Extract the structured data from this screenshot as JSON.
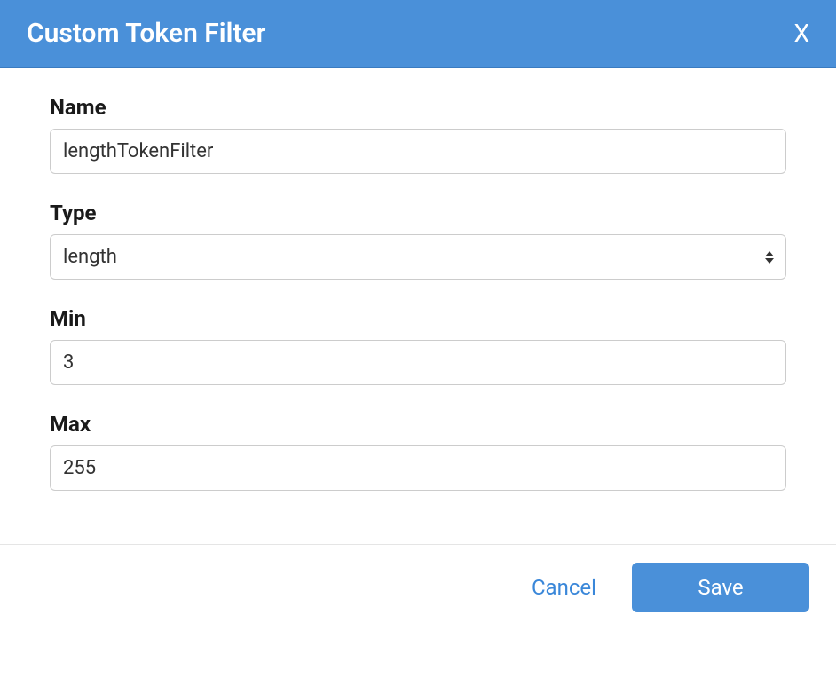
{
  "header": {
    "title": "Custom Token Filter",
    "close_label": "X"
  },
  "form": {
    "name_label": "Name",
    "name_value": "lengthTokenFilter",
    "type_label": "Type",
    "type_value": "length",
    "min_label": "Min",
    "min_value": "3",
    "max_label": "Max",
    "max_value": "255"
  },
  "footer": {
    "cancel_label": "Cancel",
    "save_label": "Save"
  }
}
